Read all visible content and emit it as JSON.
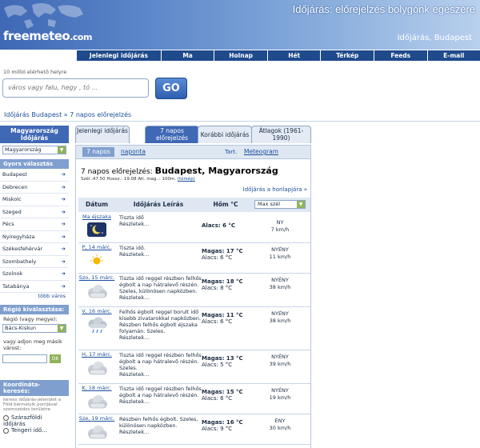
{
  "header": {
    "logo_main": "freemeteo",
    "logo_domain": ".com",
    "tagline": "Időjárás: előrejelzés bolygónk egészére",
    "location": "Időjárás, Budapest"
  },
  "nav": [
    "Jelenlegi időjárás",
    "Ma",
    "Holnap",
    "Hét",
    "Térkép",
    "Feeds",
    "E-mail"
  ],
  "search": {
    "available": "10 millió elérhető helyre",
    "placeholder": "város vagy falu, hegy , tó ...",
    "go_label": "GO"
  },
  "breadcrumb": "Időjárás Budapest » 7 napos előrejelzés",
  "sidebar": {
    "country_heading": "Magyarország Időjárás",
    "country_select": "Magyarország",
    "quick_heading": "Gyors választás",
    "cities": [
      "Budapest",
      "Debrecen",
      "Miskolc",
      "Szeged",
      "Pécs",
      "Nyíregyháza",
      "Székesfehérvár",
      "Szombathely",
      "Szolnok",
      "Tatabánya"
    ],
    "more": "több város",
    "region_heading": "Régió kiválasztása:",
    "region_label": "Régió (vagy megye):",
    "region_select": "Bács-Kiskun",
    "city_label": "vagy adjon meg másik várost:",
    "ok": "OK",
    "coord_heading": "Koordináta-keresés:",
    "coord_text": "keress időjárás-jelentést a Föld bármelyik pontjával szomszédos területre",
    "radio1": "Szárazföldi időjárás",
    "radio2": "Tengeri idő..."
  },
  "tabs": [
    {
      "label": "Jelenlegi időjárás"
    },
    {
      "label": "7 napos előrejelzés"
    },
    {
      "label": "Korábbi időjárás"
    },
    {
      "label": "Átlagok (1961-1990)"
    }
  ],
  "subtabs": {
    "seven_day": "7 napos",
    "daily": "naponta",
    "chart": "Tart.",
    "meteogram": "Meteogram"
  },
  "forecast": {
    "title_prefix": "7 napos előrejelzés:",
    "title_place": "Budapest, Magyarország",
    "coords": "Szél.:47.50 Hossz.: 19.08 Atl. mag..: 100m.",
    "map_link": "(térkép)",
    "home_link": "Időjárás a honlapjára »",
    "headers": {
      "date": "Dátum",
      "desc": "Időjárás Leírás",
      "temp": "Hőm °C",
      "wind": "Max szél"
    },
    "rows": [
      {
        "date": "Ma éjszaka",
        "desc": "Tiszta idő",
        "details": "Részletek...",
        "hi_label": "",
        "hi": "",
        "lo_label": "Alacs:",
        "lo": "6 °C",
        "wind_dir": "NY",
        "wind": "7 km/h",
        "icon": "moon-icon"
      },
      {
        "date": "P, 14 márc.",
        "desc": "Tiszta idő.",
        "details": "Részletek...",
        "hi_label": "Magas:",
        "hi": "17 °C",
        "lo_label": "Alacs:",
        "lo": "6 °C",
        "wind_dir": "NYÉNY",
        "wind": "11 km/h",
        "icon": "sun-icon"
      },
      {
        "date": "Szo, 15 márc.",
        "desc": "Tiszta idő reggel részben felhős égbolt a nap hátralevő részén. Szeles, különösen napközben.",
        "details": "Részletek...",
        "hi_label": "Magas:",
        "hi": "18 °C",
        "lo_label": "Alacs:",
        "lo": "8 °C",
        "wind_dir": "NYÉNY",
        "wind": "38 km/h",
        "icon": "cloud-icon"
      },
      {
        "date": "V, 16 márc.",
        "desc": "Felhős égbolt reggel borult idő kisebb zivatarokkal napközben. Részben felhős égbolt éjszaka folyamán. Szeles.",
        "details": "Részletek...",
        "hi_label": "Magas:",
        "hi": "11 °C",
        "lo_label": "Alacs:",
        "lo": "6 °C",
        "wind_dir": "NYÉNY",
        "wind": "38 km/h",
        "icon": "rain-icon"
      },
      {
        "date": "H, 17 márc.",
        "desc": "Tiszta idő reggel részben felhős égbolt a nap hátralevő részén. Szeles.",
        "details": "Részletek...",
        "hi_label": "Magas:",
        "hi": "13 °C",
        "lo_label": "Alacs:",
        "lo": "5 °C",
        "wind_dir": "NYÉNY",
        "wind": "39 km/h",
        "icon": "cloud-icon"
      },
      {
        "date": "K, 18 márc.",
        "desc": "Tiszta idő reggel részben felhős égbolt a nap hátralevő részén.",
        "details": "Részletek...",
        "hi_label": "Magas:",
        "hi": "15 °C",
        "lo_label": "Alacs:",
        "lo": "6 °C",
        "wind_dir": "NYÉNY",
        "wind": "19 km/h",
        "icon": "cloud-icon"
      },
      {
        "date": "Sze, 19 márc.",
        "desc": "Részben felhős égbolt. Szeles, különösen napközben.",
        "details": "Részletek...",
        "hi_label": "Magas:",
        "hi": "16 °C",
        "lo_label": "Alacs:",
        "lo": "9 °C",
        "wind_dir": "ÉNY",
        "wind": "30 km/h",
        "icon": "cloud-icon"
      }
    ]
  }
}
